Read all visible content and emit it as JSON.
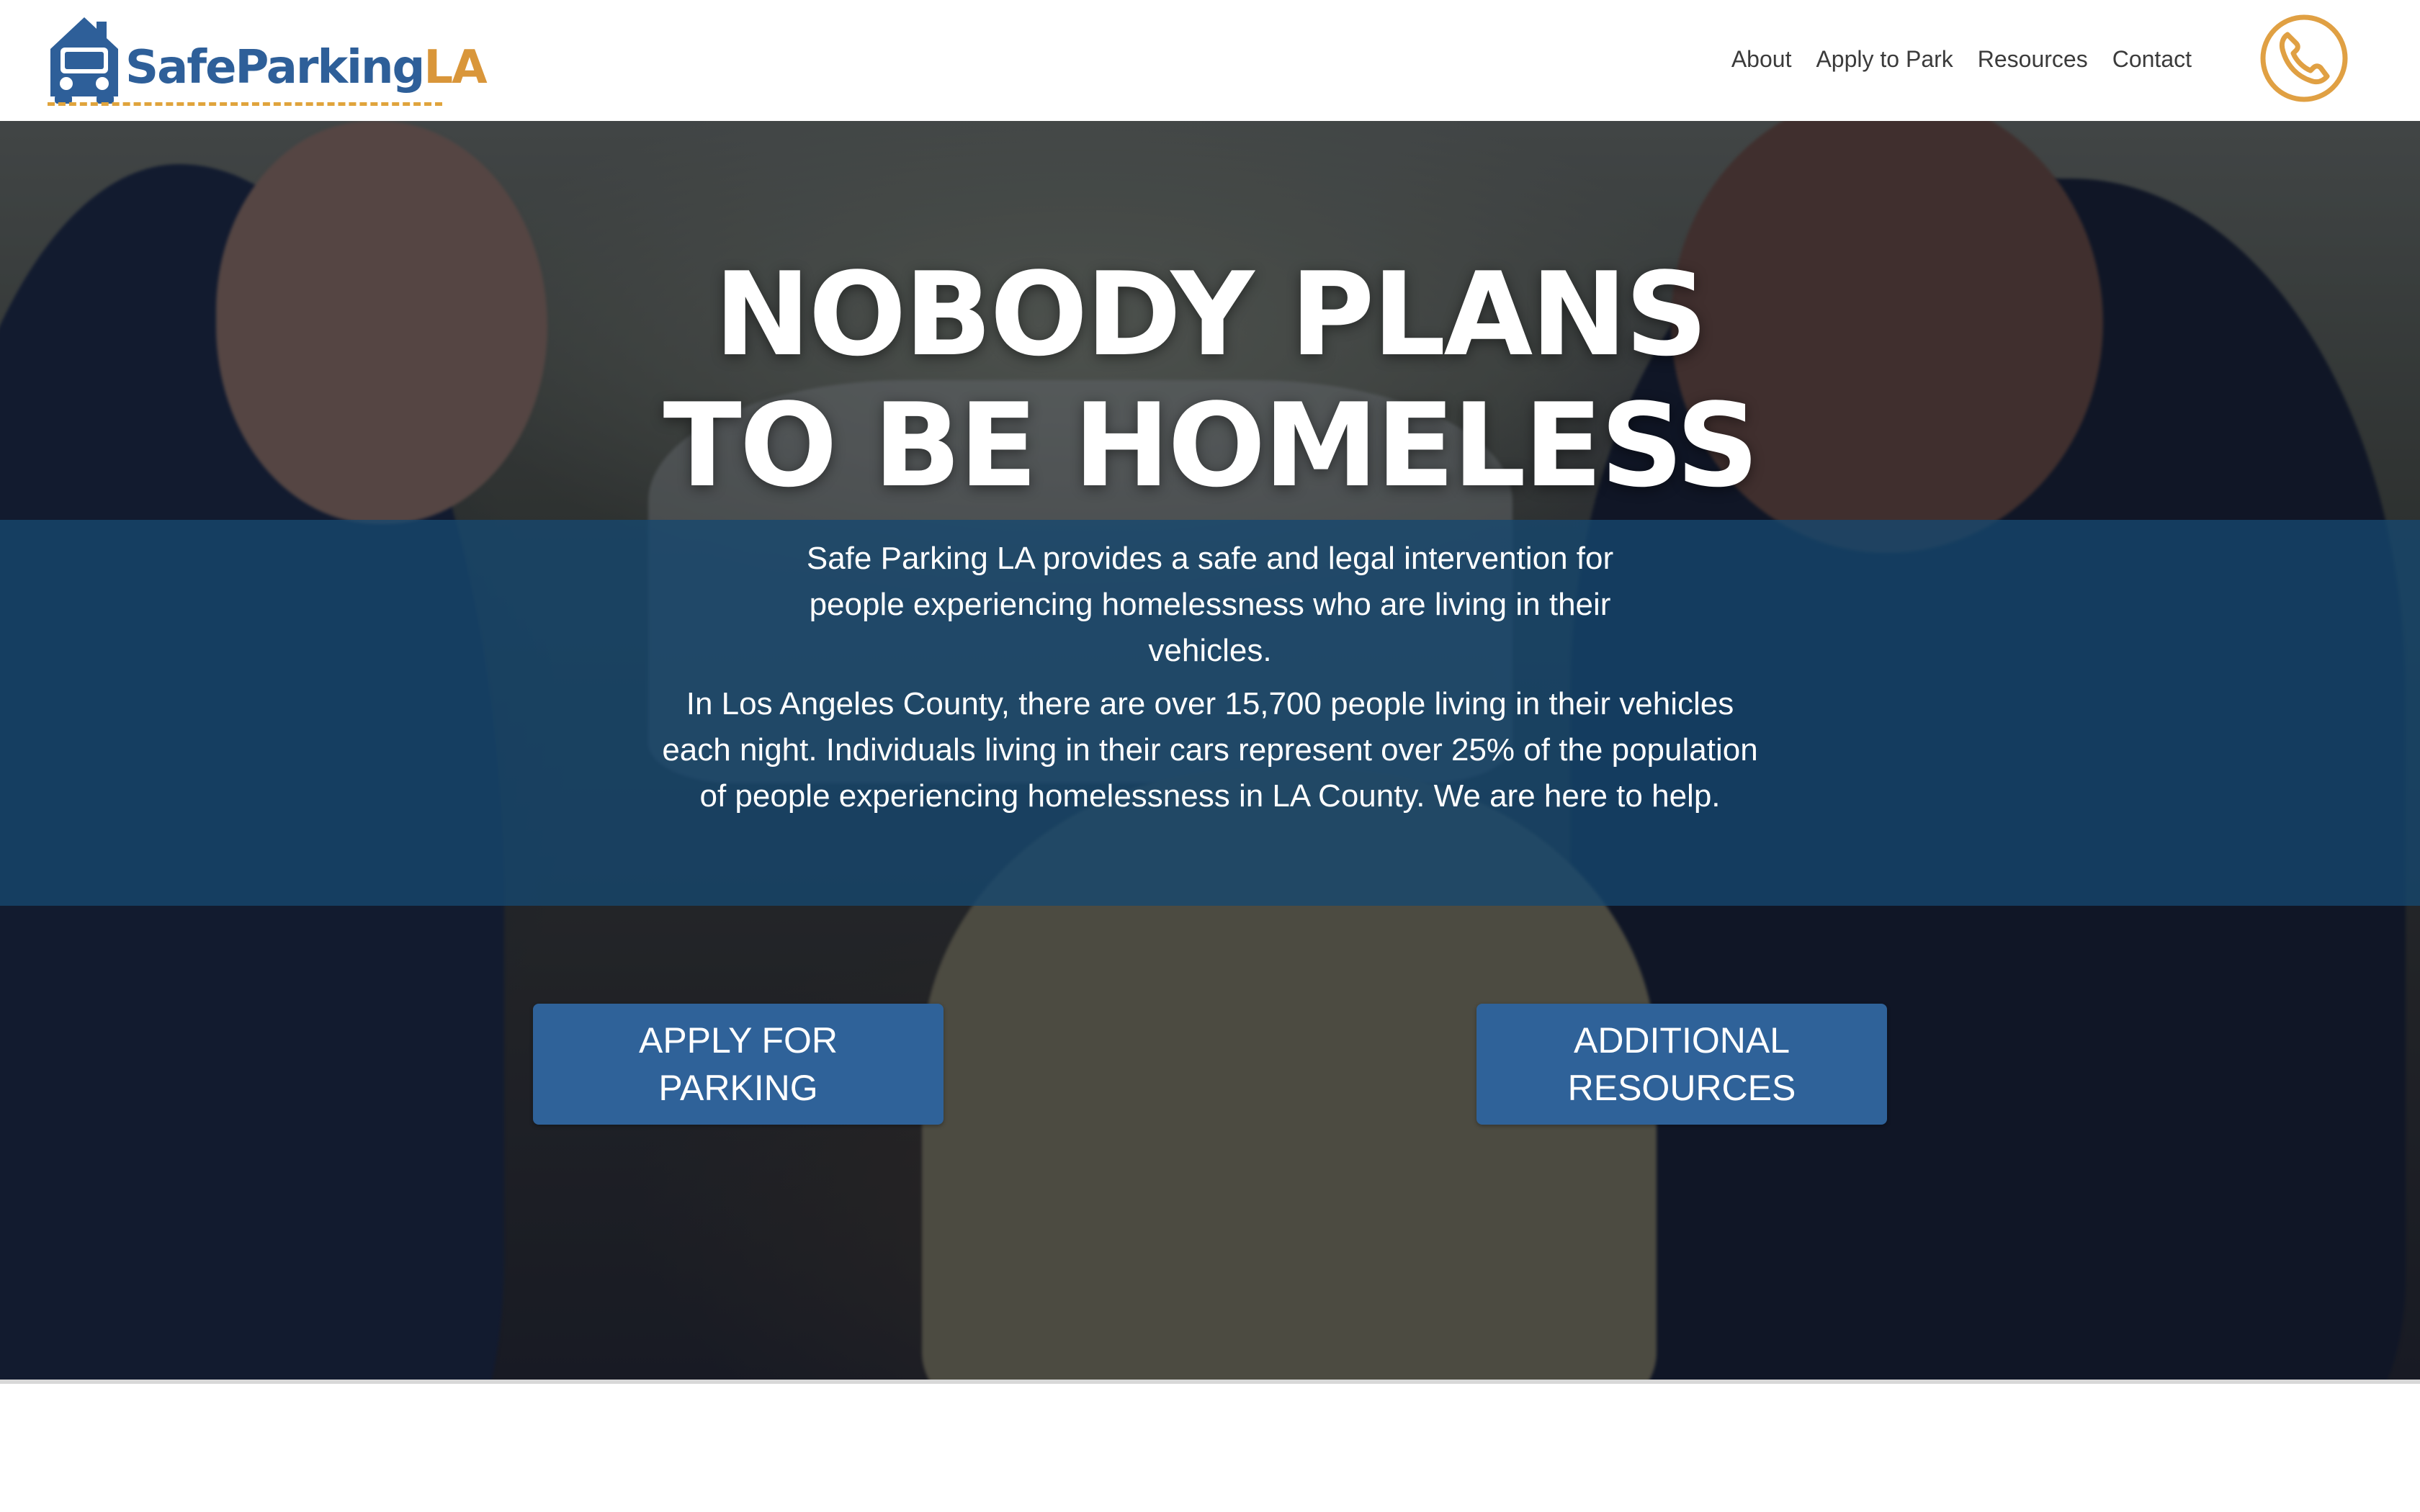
{
  "brand": {
    "logo_word1": "SafeParking",
    "logo_word2": "LA",
    "colors": {
      "blue": "#2e5f99",
      "orange": "#d9963a",
      "band": "#164870",
      "button": "#2f6299"
    }
  },
  "nav": {
    "items": [
      {
        "label": "About"
      },
      {
        "label": "Apply to Park"
      },
      {
        "label": "Resources"
      },
      {
        "label": "Contact"
      }
    ],
    "phone_icon": "phone-icon"
  },
  "hero": {
    "title_line1": "NOBODY PLANS",
    "title_line2": "TO BE HOMELESS",
    "intro": "Safe Parking LA provides a safe and legal intervention for people experiencing homelessness who are living in their vehicles.",
    "stats": "In Los Angeles County, there are over 15,700 people living in their vehicles each night. Individuals living in their cars represent over 25% of the population of people experiencing homelessness in LA County. We are here to help.",
    "apply_button": "APPLY FOR PARKING",
    "resources_button": "ADDITIONAL RESOURCES"
  }
}
